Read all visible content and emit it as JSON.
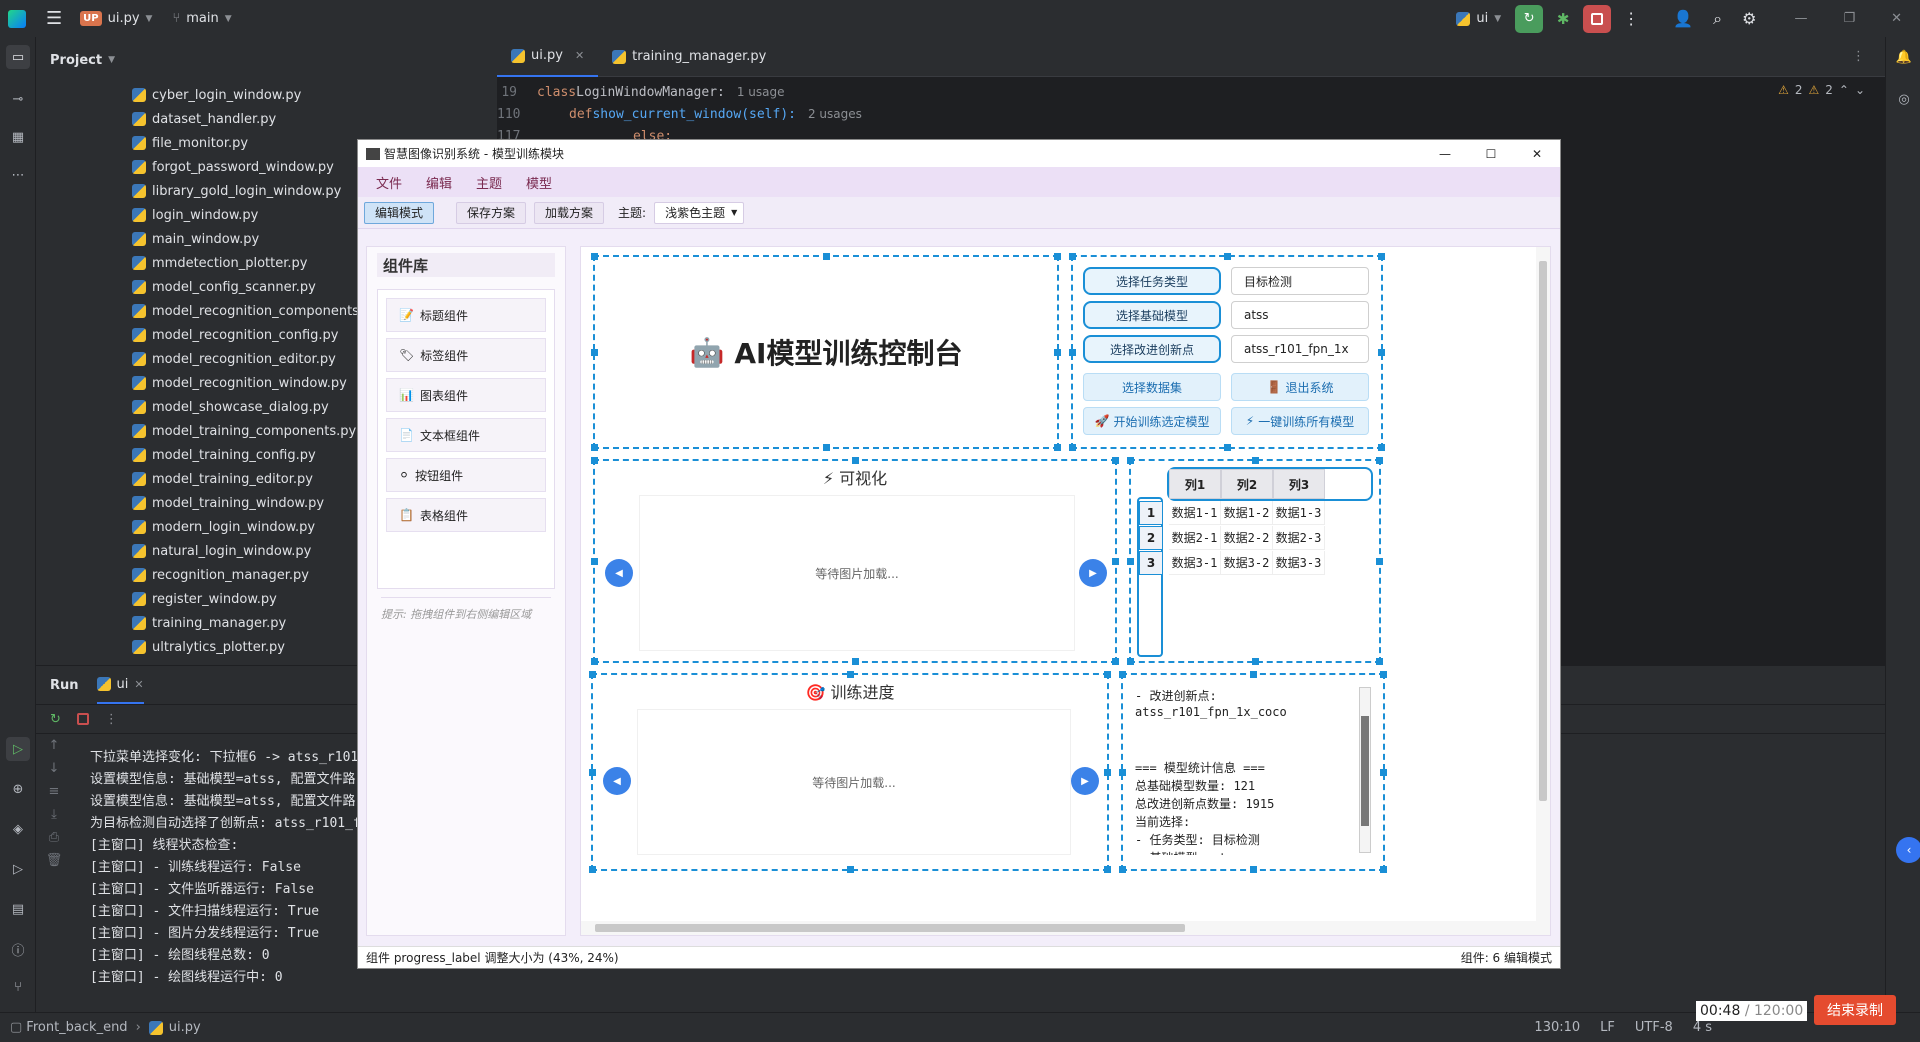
{
  "titlebar": {
    "project_badge": "UP",
    "file": "ui.py",
    "branch": "main",
    "run_config": "ui"
  },
  "project_panel": {
    "title": "Project",
    "files": [
      "cyber_login_window.py",
      "dataset_handler.py",
      "file_monitor.py",
      "forgot_password_window.py",
      "library_gold_login_window.py",
      "login_window.py",
      "main_window.py",
      "mmdetection_plotter.py",
      "model_config_scanner.py",
      "model_recognition_components.py",
      "model_recognition_config.py",
      "model_recognition_editor.py",
      "model_recognition_window.py",
      "model_showcase_dialog.py",
      "model_training_components.py",
      "model_training_config.py",
      "model_training_editor.py",
      "model_training_window.py",
      "modern_login_window.py",
      "natural_login_window.py",
      "recognition_manager.py",
      "register_window.py",
      "training_manager.py",
      "ultralytics_plotter.py"
    ]
  },
  "editor": {
    "tabs": [
      {
        "label": "ui.py"
      },
      {
        "label": "training_manager.py"
      }
    ],
    "lines": [
      {
        "num": "19",
        "code_kw": "class",
        "code_rest": " LoginWindowManager:",
        "hint": "1 usage"
      },
      {
        "num": "110",
        "code_kw": "def",
        "code_rest": " show_current_window(self):",
        "hint": "2 usages"
      },
      {
        "num": "117",
        "code_kw": "",
        "code_rest": "else:",
        "hint": ""
      }
    ],
    "warnings_a": "2",
    "warnings_b": "2"
  },
  "run_panel": {
    "title": "Run",
    "tab": "ui",
    "lines": [
      "下拉菜单选择变化: 下拉框6 -> atss_r101",
      "设置模型信息: 基础模型=atss, 配置文件路",
      "设置模型信息: 基础模型=atss, 配置文件路",
      "为目标检测自动选择了创新点: atss_r101_f",
      "[主窗口] 线程状态检查:",
      "[主窗口] - 训练线程运行: False",
      "[主窗口] - 文件监听器运行: False",
      "[主窗口] - 文件扫描线程运行: True",
      "[主窗口] - 图片分发线程运行: True",
      "[主窗口] - 绘图线程总数: 0",
      "[主窗口] - 绘图线程运行中: 0"
    ]
  },
  "statusbar": {
    "project": "Front_back_end",
    "file": "ui.py",
    "position": "130:10",
    "line_sep": "LF",
    "encoding": "UTF-8",
    "indent": "4 s"
  },
  "recording": {
    "elapsed": "00:48",
    "total": "/ 120:00",
    "stop_label": "结束录制"
  },
  "dialog": {
    "title": "智慧图像识别系统 - 模型训练模块",
    "menu": [
      "文件",
      "编辑",
      "主题",
      "模型"
    ],
    "toolbar": {
      "edit_mode": "编辑模式",
      "save_plan": "保存方案",
      "load_plan": "加载方案",
      "theme_label": "主题:",
      "theme_value": "浅紫色主题"
    },
    "library": {
      "title": "组件库",
      "items": [
        {
          "icon": "📝",
          "label": "标题组件"
        },
        {
          "icon": "🏷",
          "label": "标签组件"
        },
        {
          "icon": "📊",
          "label": "图表组件"
        },
        {
          "icon": "📄",
          "label": "文本框组件"
        },
        {
          "icon": "⚪",
          "label": "按钮组件"
        },
        {
          "icon": "📋",
          "label": "表格组件"
        }
      ],
      "hint": "提示: 拖拽组件到右侧编辑区域"
    },
    "header_title": "AI模型训练控制台",
    "controls": {
      "task_btn": "选择任务类型",
      "task_value": "目标检测",
      "base_btn": "选择基础模型",
      "base_value": "atss",
      "innov_btn": "选择改进创新点",
      "innov_value": "atss_r101_fpn_1x",
      "dataset_btn": "选择数据集",
      "exit_btn": "退出系统",
      "train_sel_btn": "开始训练选定模型",
      "train_all_btn": "一键训练所有模型"
    },
    "viz": {
      "title": "可视化",
      "placeholder": "等待图片加载..."
    },
    "progress": {
      "title": "训练进度",
      "placeholder": "等待图片加载..."
    },
    "table": {
      "columns": [
        "列1",
        "列2",
        "列3"
      ],
      "row_headers": [
        "1",
        "2",
        "3"
      ],
      "rows": [
        [
          "数据1-1",
          "数据1-2",
          "数据1-3"
        ],
        [
          "数据2-1",
          "数据2-2",
          "数据2-3"
        ],
        [
          "数据3-1",
          "数据3-2",
          "数据3-3"
        ]
      ]
    },
    "info_log": [
      "- 改进创新点:",
      "atss_r101_fpn_1x_coco",
      "",
      "",
      "=== 模型统计信息 ===",
      "总基础模型数量: 121",
      "总改进创新点数量: 1915",
      "当前选择:",
      "- 任务类型: 目标检测",
      "- 基础模型: atss"
    ],
    "status_left": "组件 progress_label 调整大小为 (43%, 24%)",
    "status_right": "组件: 6  编辑模式"
  }
}
